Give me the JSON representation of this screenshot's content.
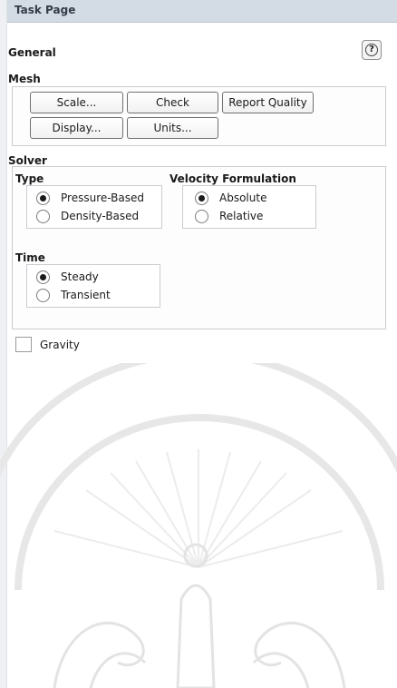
{
  "task_page": {
    "title": "Task Page"
  },
  "general": {
    "heading": "General",
    "help_glyph": "?"
  },
  "mesh": {
    "heading": "Mesh",
    "buttons": [
      "Scale...",
      "Check",
      "Report Quality",
      "Display...",
      "Units..."
    ]
  },
  "solver": {
    "heading": "Solver",
    "type": {
      "heading": "Type",
      "options": [
        "Pressure-Based",
        "Density-Based"
      ],
      "selected": "Pressure-Based"
    },
    "velocity_formulation": {
      "heading": "Velocity Formulation",
      "options": [
        "Absolute",
        "Relative"
      ],
      "selected": "Absolute"
    },
    "time": {
      "heading": "Time",
      "options": [
        "Steady",
        "Transient"
      ],
      "selected": "Steady"
    }
  },
  "gravity": {
    "label": "Gravity",
    "checked": false
  },
  "icons": [
    "help-icon"
  ],
  "colors": {
    "titlebar": "#d3dbe5",
    "group_border": "#c9ccd1",
    "watermark": "#e6e6e6"
  }
}
